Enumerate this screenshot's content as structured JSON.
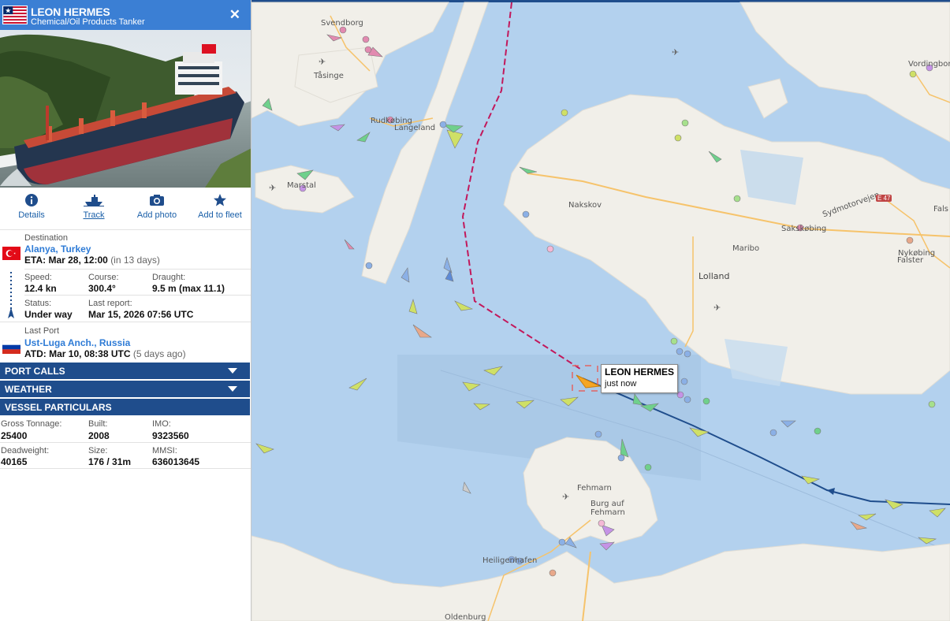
{
  "vessel": {
    "name": "LEON HERMES",
    "type": "Chemical/Oil Products Tanker"
  },
  "actions": [
    {
      "label": "Details",
      "icon": "info-icon"
    },
    {
      "label": "Track",
      "icon": "ship-track-icon"
    },
    {
      "label": "Add photo",
      "icon": "camera-icon"
    },
    {
      "label": "Add to fleet",
      "icon": "star-icon"
    }
  ],
  "destination": {
    "label": "Destination",
    "port": "Alanya, Turkey",
    "eta_label": "ETA:",
    "eta": "Mar 28, 12:00",
    "eta_rel": "(in 13 days)"
  },
  "voyage": {
    "speed_label": "Speed:",
    "speed": "12.4 kn",
    "course_label": "Course:",
    "course": "300.4°",
    "draught_label": "Draught:",
    "draught": "9.5 m (max 11.1)",
    "status_label": "Status:",
    "status": "Under way",
    "report_label": "Last report:",
    "report": "Mar 15, 2026 07:56 UTC"
  },
  "last_port": {
    "label": "Last Port",
    "port": "Ust-Luga Anch., Russia",
    "atd_label": "ATD:",
    "atd": "Mar 10, 08:38 UTC",
    "atd_rel": "(5 days ago)"
  },
  "sections": {
    "port_calls": "PORT CALLS",
    "weather": "WEATHER",
    "particulars": "VESSEL PARTICULARS"
  },
  "particulars": {
    "gt_label": "Gross Tonnage:",
    "gt": "25400",
    "built_label": "Built:",
    "built": "2008",
    "imo_label": "IMO:",
    "imo": "9323560",
    "dwt_label": "Deadweight:",
    "dwt": "40165",
    "size_label": "Size:",
    "size": "176 / 31m",
    "mmsi_label": "MMSI:",
    "mmsi": "636013645"
  },
  "map": {
    "places": {
      "svendborg": "Svendborg",
      "tasinge": "Tåsinge",
      "rudkobing": "Rudkøbing",
      "langeland": "Langeland",
      "marstal": "Marstal",
      "nakskov": "Nakskov",
      "maribo": "Maribo",
      "lolland": "Lolland",
      "sakskobing": "Sakskøbing",
      "vordingborg": "Vordingborg",
      "nykobing": "Nykøbing",
      "falster": "Falster",
      "fals": "Fals",
      "sydmotorvejen": "Sydmotorvejen",
      "e47": "E 47",
      "fehmarn": "Fehmarn",
      "burg": "Burg auf",
      "burg2": "Fehmarn",
      "heiligenhafen": "Heiligenhafen",
      "oldenburg": "Oldenburg"
    },
    "callout": {
      "name": "LEON HERMES",
      "time": "just now"
    }
  },
  "colors": {
    "header": "#3b7fd4",
    "section_bar": "#1f4d8c",
    "link": "#2e7bd6",
    "sea": "#b3d1ee",
    "land": "#f1efe9",
    "track": "#1f4d8c",
    "route": "#c2185b",
    "vessel": "#f5a623"
  }
}
